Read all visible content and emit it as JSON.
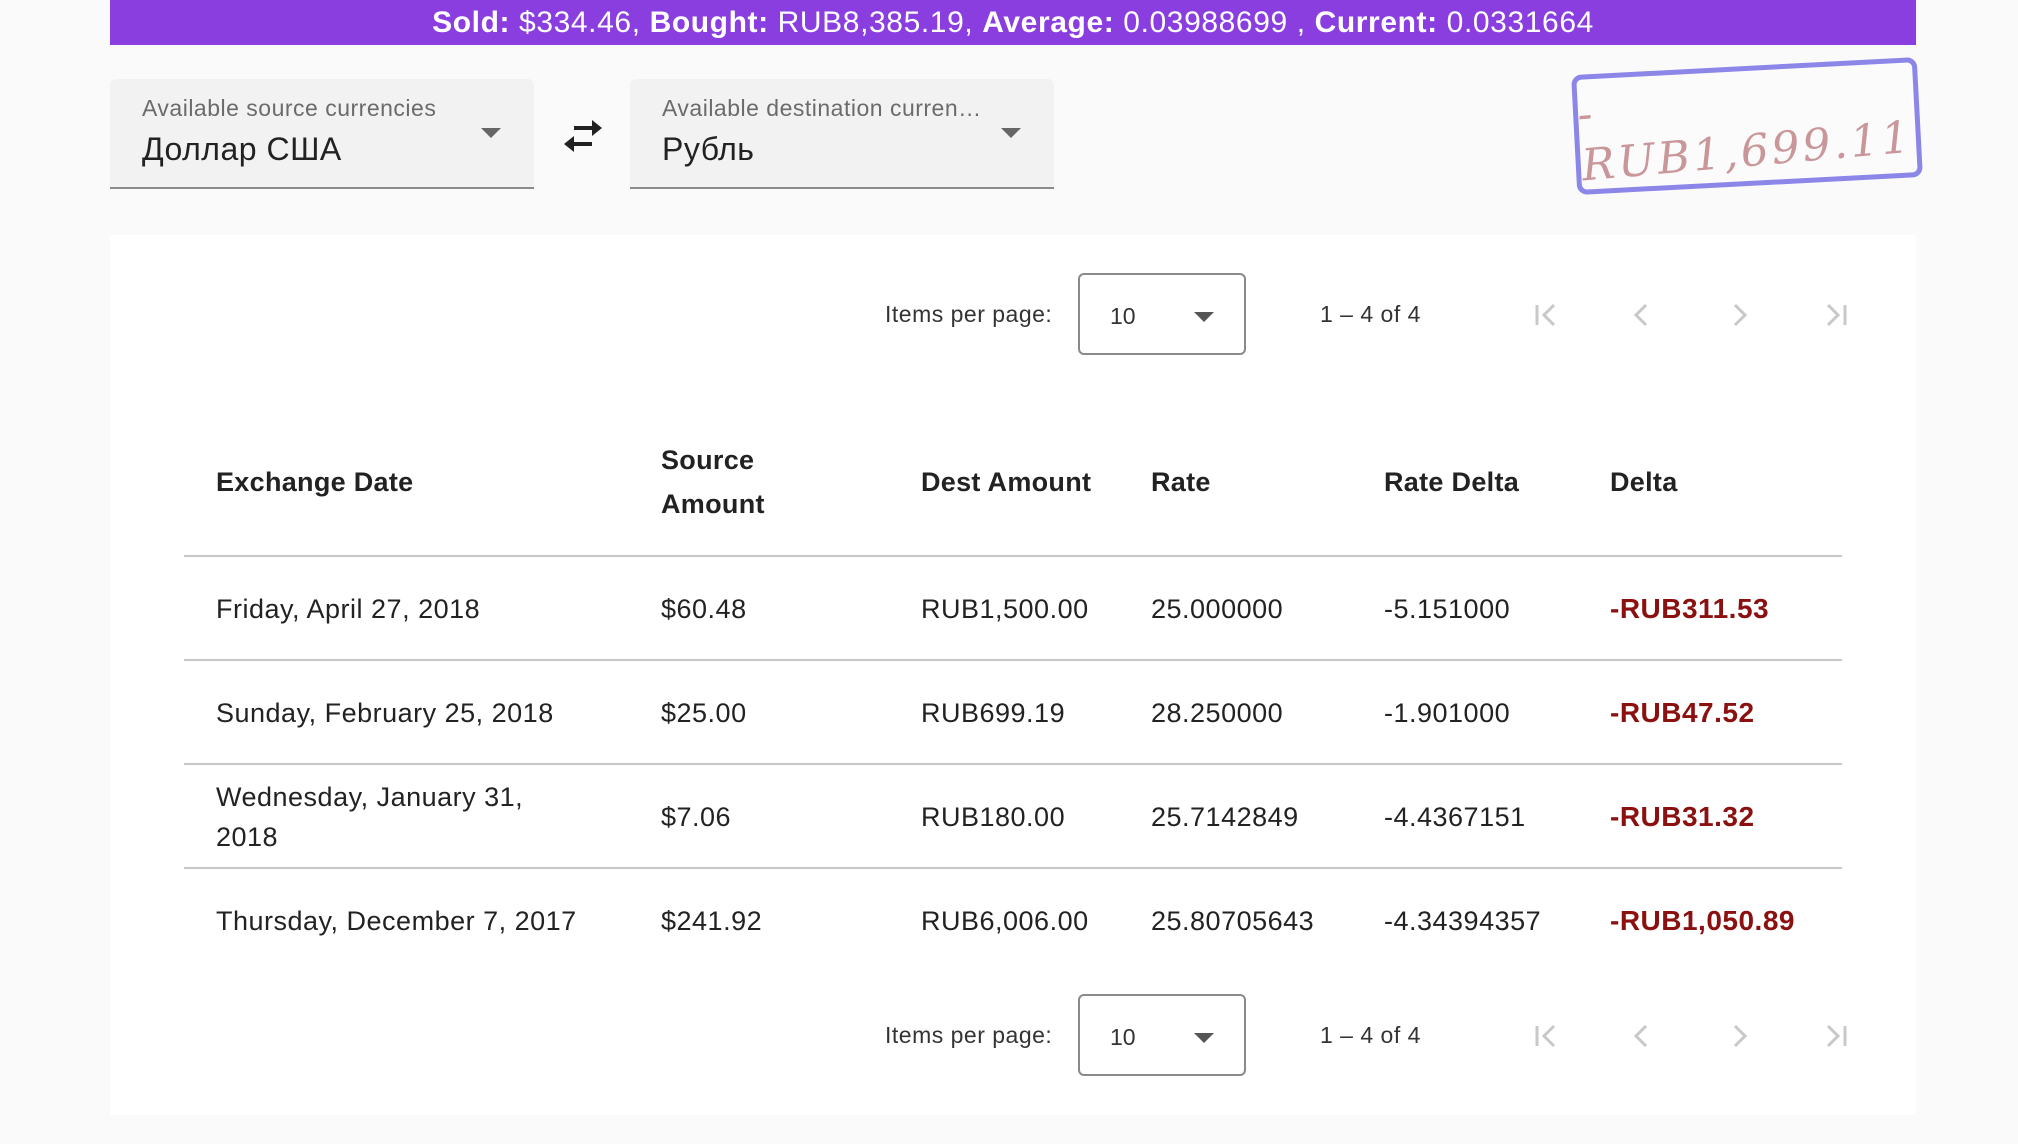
{
  "summary": {
    "sold_label": "Sold:",
    "sold_value": "$334.46,",
    "bought_label": "Bought:",
    "bought_value": "RUB8,385.19,",
    "average_label": "Average:",
    "average_value": "0.03988699 ,",
    "current_label": "Current:",
    "current_value": "0.0331664"
  },
  "source_select": {
    "label": "Available source currencies",
    "value": "Доллар США"
  },
  "destination_select": {
    "label": "Available destination currencies",
    "value": "Рубль"
  },
  "stamp": {
    "text": "-RUB1,699.11"
  },
  "paginator": {
    "items_per_page_label": "Items per page:",
    "items_per_page_value": "10",
    "range_label": "1 – 4 of 4"
  },
  "table": {
    "headers": [
      "Exchange Date",
      "Source Amount",
      "Dest Amount",
      "Rate",
      "Rate Delta",
      "Delta"
    ],
    "rows": [
      {
        "date": "Friday, April 27, 2018",
        "source": "$60.48",
        "dest": "RUB1,500.00",
        "rate": "25.000000",
        "rate_delta": "-5.151000",
        "delta": "-RUB311.53"
      },
      {
        "date": "Sunday, February 25, 2018",
        "source": "$25.00",
        "dest": "RUB699.19",
        "rate": "28.250000",
        "rate_delta": "-1.901000",
        "delta": "-RUB47.52"
      },
      {
        "date": "Wednesday, January 31, 2018",
        "source": "$7.06",
        "dest": "RUB180.00",
        "rate": "25.7142849",
        "rate_delta": "-4.4367151",
        "delta": "-RUB31.32"
      },
      {
        "date": "Thursday, December 7, 2017",
        "source": "$241.92",
        "dest": "RUB6,006.00",
        "rate": "25.80705643",
        "rate_delta": "-4.34394357",
        "delta": "-RUB1,050.89"
      }
    ]
  },
  "colors": {
    "banner": "#8a3ee0",
    "negative_delta": "#8b1010",
    "stamp_border": "#8b86e8",
    "stamp_text": "#c9969a"
  },
  "icons": {
    "swap": "swap-horiz-icon",
    "first": "first-page-icon",
    "prev": "chevron-left-icon",
    "next": "chevron-right-icon",
    "last": "last-page-icon"
  }
}
